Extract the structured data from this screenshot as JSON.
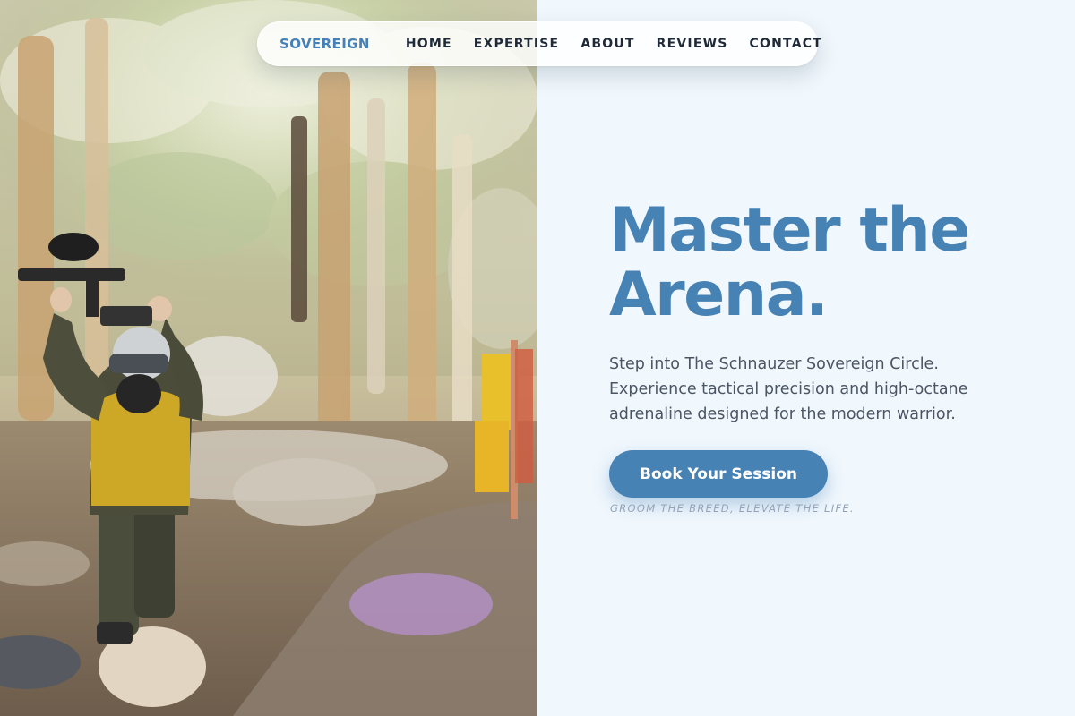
{
  "nav": {
    "brand": "SOVEREIGN",
    "links": [
      "HOME",
      "EXPERTISE",
      "ABOUT",
      "REVIEWS",
      "CONTACT"
    ]
  },
  "hero": {
    "title_line1": "Master the",
    "title_line2": "Arena.",
    "body": "Step into The Schnauzer Sovereign Circle. Experience tactical precision and high-octane adrenaline designed for the modern warrior.",
    "cta_label": "Book Your Session",
    "tagline": "GROOM THE BREED, ELEVATE THE LIFE."
  },
  "image": {
    "subject": "paintball-player-photo"
  },
  "colors": {
    "accent": "#4682b4",
    "background": "#f0f7fd",
    "nav_text": "#1f2937",
    "body_text": "#4b5563",
    "tagline": "#94a3b8"
  }
}
